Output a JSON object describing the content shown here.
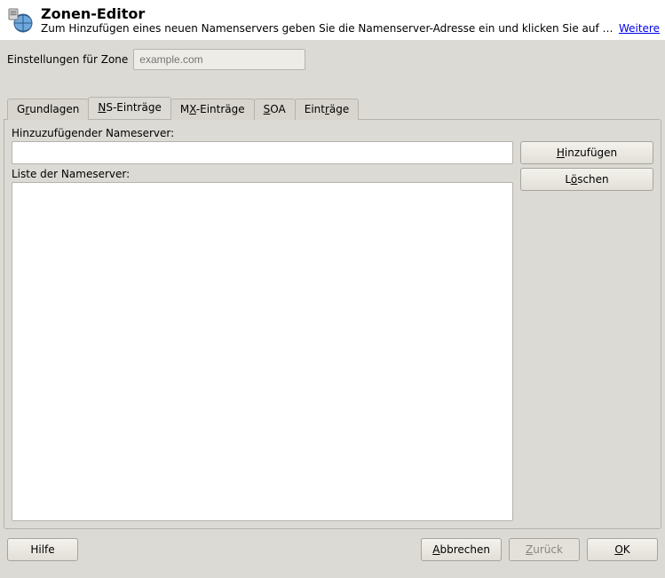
{
  "header": {
    "title": "Zonen-Editor",
    "subtitle": "Zum Hinzufügen eines neuen Namenservers geben Sie die Namenserver-Adresse ein und klicken Sie auf Hinz…",
    "more": "Weitere"
  },
  "settings": {
    "label": "Einstellungen für Zone",
    "placeholder": "example.com",
    "value": ""
  },
  "tabs": {
    "grundlagen": {
      "pre": "G",
      "u": "r",
      "post": "undlagen"
    },
    "ns": {
      "pre": "",
      "u": "N",
      "post": "S-Einträge"
    },
    "mx": {
      "pre": "M",
      "u": "X",
      "post": "-Einträge"
    },
    "soa": {
      "pre": "",
      "u": "S",
      "post": "OA"
    },
    "eintraege": {
      "pre": "Eint",
      "u": "r",
      "post": "äge"
    }
  },
  "panel": {
    "add_label": "Hinzuzufügender Nameserver:",
    "add_value": "",
    "add_btn": {
      "pre": "",
      "u": "H",
      "post": "inzufügen"
    },
    "list_label": {
      "pre": "Liste der Na",
      "u": "m",
      "post": "eserver:"
    },
    "del_btn": {
      "pre": "L",
      "u": "ö",
      "post": "schen"
    }
  },
  "footer": {
    "help": {
      "text": "Hilfe"
    },
    "cancel": {
      "pre": "",
      "u": "A",
      "post": "bbrechen"
    },
    "back": {
      "pre": "",
      "u": "Z",
      "post": "urück"
    },
    "ok": {
      "pre": "",
      "u": "O",
      "post": "K"
    }
  }
}
